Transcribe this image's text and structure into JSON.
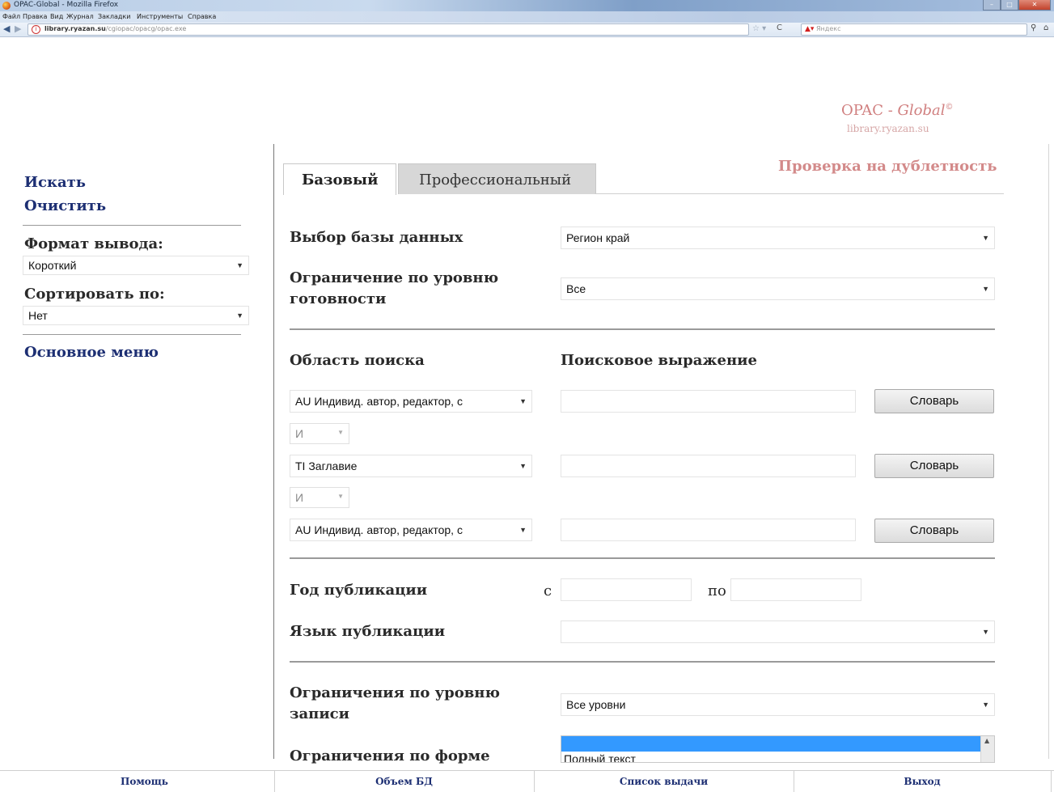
{
  "browser": {
    "window_title": "OPAC-Global - Mozilla Firefox",
    "menu": [
      "Файл",
      "Правка",
      "Вид",
      "Журнал",
      "Закладки",
      "Инструменты",
      "Справка"
    ],
    "url_host": "library.ryazan.su",
    "url_path": "/cgiopac/opacg/opac.exe",
    "search_placeholder": "Яндекс"
  },
  "brand": {
    "name": "OPAC - ",
    "name_italic": "Global",
    "copyright": "©",
    "url": "library.ryazan.su"
  },
  "sidebar": {
    "search_link": "Искать",
    "clear_link": "Очистить",
    "format_label": "Формат вывода:",
    "format_value": "Короткий",
    "sort_label": "Сортировать по:",
    "sort_value": "Нет",
    "main_menu_link": "Основное меню"
  },
  "tabs": {
    "basic": "Базовый",
    "professional": "Профессиональный"
  },
  "duplicate_check": "Проверка на дублетность",
  "form": {
    "db_label": "Выбор базы данных",
    "db_value": "Регион край",
    "readiness_label_1": "Ограничение по уровню",
    "readiness_label_2": "готовности",
    "readiness_value": "Все",
    "area_header": "Область поиска",
    "expr_header": "Поисковое выражение",
    "rows": [
      {
        "field": "AU Индивид. автор, редактор, с",
        "dict": "Словарь"
      },
      {
        "field": "TI Заглавие",
        "dict": "Словарь"
      },
      {
        "field": "AU Индивид. автор, редактор, с",
        "dict": "Словарь"
      }
    ],
    "operators": [
      "И",
      "И"
    ],
    "year_label": "Год публикации",
    "year_from": "с",
    "year_to": "по",
    "lang_label": "Язык публикации",
    "lang_value": "",
    "record_level_label_1": "Ограничения по уровню",
    "record_level_label_2": "записи",
    "record_level_value": "Все уровни",
    "form_label": "Ограничения по форме",
    "form_option_2": "Полный текст"
  },
  "footer": [
    "Помощь",
    "Объем БД",
    "Список выдачи",
    "Выход"
  ]
}
